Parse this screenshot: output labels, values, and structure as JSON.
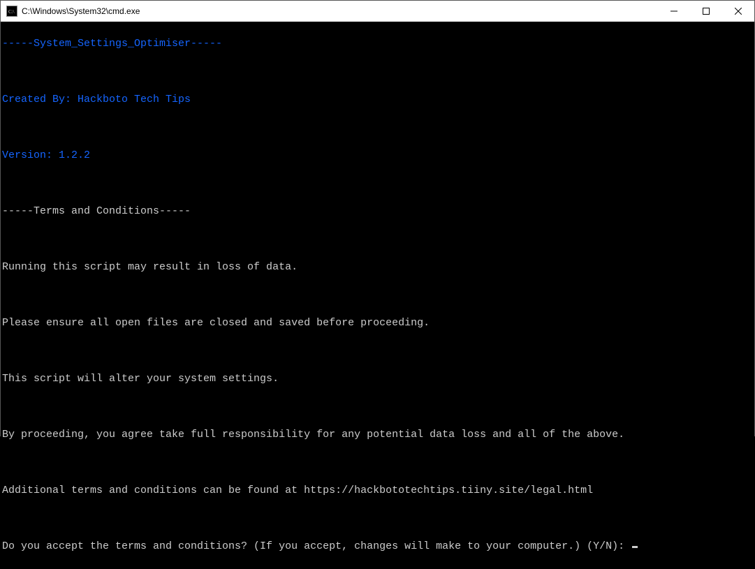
{
  "window": {
    "title": "C:\\Windows\\System32\\cmd.exe"
  },
  "terminal": {
    "header_line": "-----System_Settings_Optimiser-----",
    "created_by": "Created By: Hackboto Tech Tips",
    "version": "Version: 1.2.2",
    "terms_header": "-----Terms and Conditions-----",
    "line1": "Running this script may result in loss of data.",
    "line2": "Please ensure all open files are closed and saved before proceeding.",
    "line3": "This script will alter your system settings.",
    "line4": "By proceeding, you agree take full responsibility for any potential data loss and all of the above.",
    "line5": "Additional terms and conditions can be found at https://hackbototechtips.tiiny.site/legal.html",
    "prompt": "Do you accept the terms and conditions? (If you accept, changes will make to your computer.) (Y/N): "
  }
}
